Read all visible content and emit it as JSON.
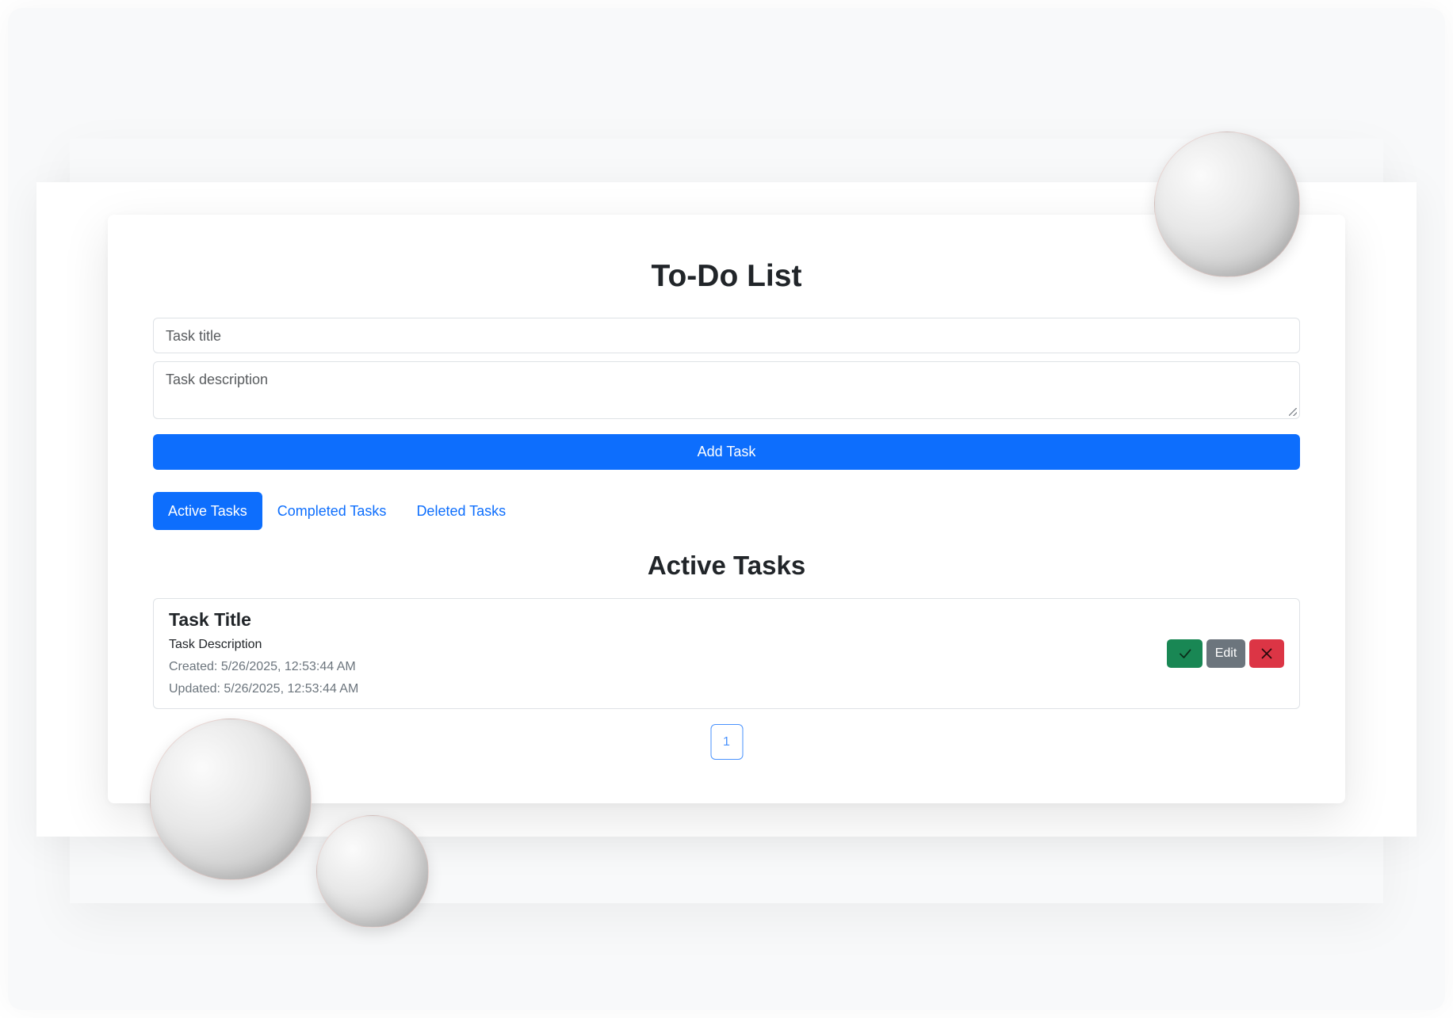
{
  "app": {
    "title": "To-Do List"
  },
  "form": {
    "title_placeholder": "Task title",
    "description_placeholder": "Task description",
    "add_button": "Add Task"
  },
  "tabs": [
    {
      "label": "Active Tasks",
      "active": true
    },
    {
      "label": "Completed Tasks",
      "active": false
    },
    {
      "label": "Deleted Tasks",
      "active": false
    }
  ],
  "section": {
    "title": "Active Tasks"
  },
  "tasks": [
    {
      "title": "Task Title",
      "description": "Task Description",
      "created": "Created: 5/26/2025, 12:53:44 AM",
      "updated": "Updated: 5/26/2025, 12:53:44 AM",
      "actions": {
        "complete_icon": "check-icon",
        "edit_label": "Edit",
        "delete_icon": "x-icon"
      }
    }
  ],
  "pagination": {
    "pages": [
      "1"
    ],
    "current": "1"
  },
  "colors": {
    "primary": "#0d6efd",
    "success": "#198754",
    "secondary": "#6c757d",
    "danger": "#dc3545",
    "backdrop": "#f8f9fa"
  }
}
